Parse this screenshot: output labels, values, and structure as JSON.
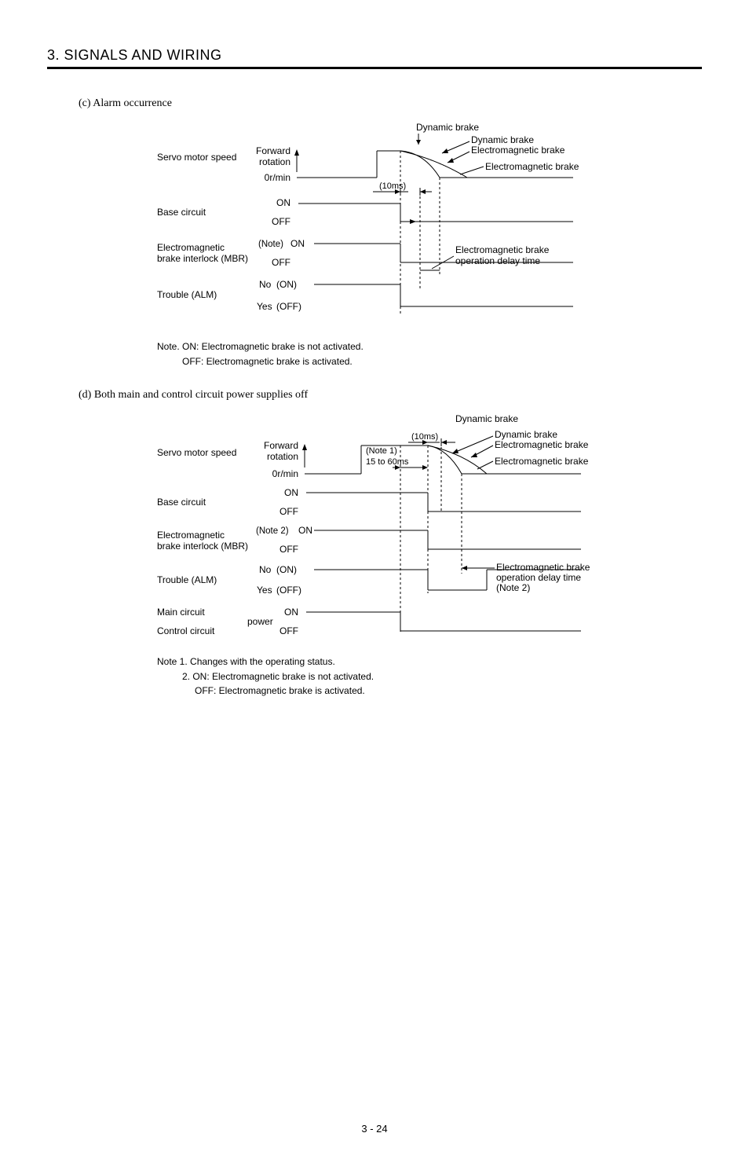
{
  "header": "3. SIGNALS AND WIRING",
  "section_c": {
    "caption": "(c) Alarm occurrence",
    "top_label": "Dynamic brake",
    "callouts": {
      "db": "Dynamic brake",
      "emb": "Electromagnetic brake",
      "emb2": "Electromagnetic brake"
    },
    "rows": {
      "speed": {
        "label": "Servo motor speed",
        "s1": "Forward",
        "s2": "rotation",
        "s3": "0r/min",
        "timing": "(10ms)"
      },
      "base": {
        "label": "Base circuit",
        "on": "ON",
        "off": "OFF"
      },
      "mbr": {
        "label1": "Electromagnetic",
        "label2": "brake interlock (MBR)",
        "note": "(Note)",
        "on": "ON",
        "off": "OFF",
        "callout": "Electromagnetic brake operation delay time"
      },
      "alm": {
        "label": "Trouble (ALM)",
        "no": "No",
        "on": "(ON)",
        "yes": "Yes",
        "off": "(OFF)"
      }
    },
    "note": {
      "line1": "Note. ON: Electromagnetic brake is not activated.",
      "line2": "OFF: Electromagnetic brake is activated."
    }
  },
  "section_d": {
    "caption": "(d) Both main and control circuit power supplies off",
    "top_label": "Dynamic brake",
    "callouts": {
      "db": "Dynamic brake",
      "emb": "Electromagnetic brake",
      "emb2": "Electromagnetic brake"
    },
    "rows": {
      "speed": {
        "label": "Servo motor speed",
        "s1": "Forward",
        "s2": "rotation",
        "s3": "0r/min",
        "timing10": "(10ms)",
        "note1": "(Note 1)",
        "timing60": "15 to 60ms"
      },
      "base": {
        "label": "Base circuit",
        "on": "ON",
        "off": "OFF"
      },
      "mbr": {
        "label1": "Electromagnetic",
        "label2": "brake interlock (MBR)",
        "note": "(Note 2)",
        "on": "ON",
        "off": "OFF",
        "callout1": "Electromagnetic brake",
        "callout2": "operation delay time",
        "callout3": "(Note 2)"
      },
      "alm": {
        "label": "Trouble (ALM)",
        "no": "No",
        "on": "(ON)",
        "yes": "Yes",
        "off": "(OFF)"
      },
      "power": {
        "label1": "Main circuit",
        "label2": "power",
        "label3": "Control circuit",
        "on": "ON",
        "off": "OFF"
      }
    },
    "note": {
      "line1": "Note 1. Changes with the operating status.",
      "line2": "2. ON: Electromagnetic brake is not activated.",
      "line3": "OFF: Electromagnetic brake is activated."
    }
  },
  "page": "3 -  24"
}
